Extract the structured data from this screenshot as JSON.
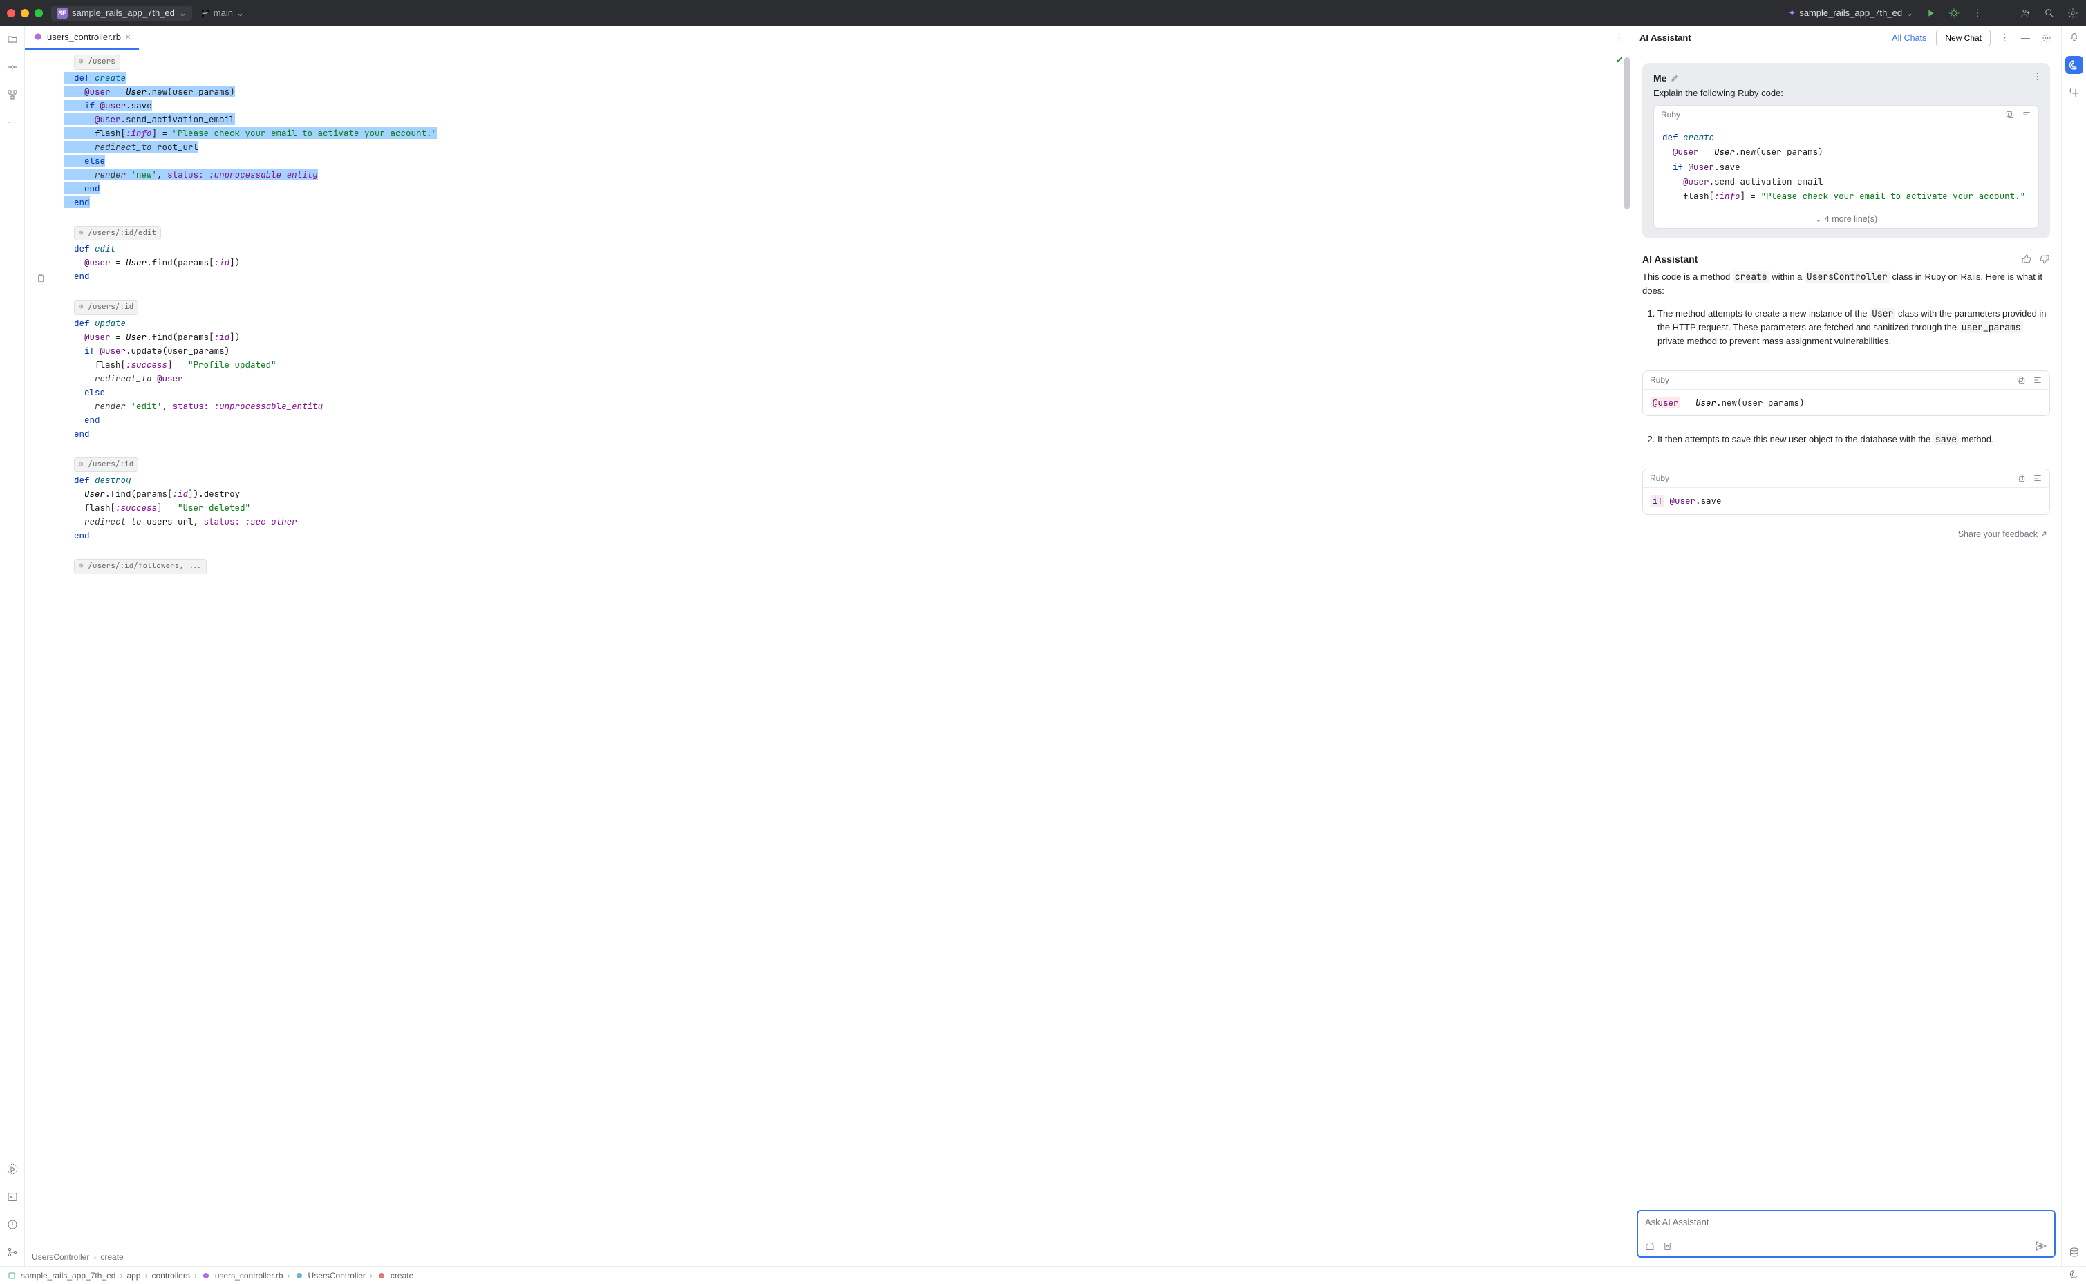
{
  "titlebar": {
    "project_short": "SE",
    "project_name": "sample_rails_app_7th_ed",
    "branch": "main",
    "run_config": "sample_rails_app_7th_ed"
  },
  "tabs": {
    "file_name": "users_controller.rb"
  },
  "routes": {
    "users": "/users",
    "edit": "/users/:id/edit",
    "show": "/users/:id",
    "show2": "/users/:id",
    "followers": "/users/:id/followers, ..."
  },
  "crumbs": {
    "c1": "UsersController",
    "c2": "create"
  },
  "ai": {
    "header": "AI Assistant",
    "all_chats": "All Chats",
    "new_chat": "New Chat",
    "me_label": "Me",
    "me_prompt": "Explain the following Ruby code:",
    "code_lang": "Ruby",
    "more_lines": "4 more line(s)",
    "assistant_label": "AI Assistant",
    "response_p1a": "This code is a method ",
    "response_p1_code1": "create",
    "response_p1b": " within a ",
    "response_p1_code2": "UsersController",
    "response_p1c": " class in Ruby on Rails. Here is what it does:",
    "li1a": "The method attempts to create a new instance of the ",
    "li1_code1": "User",
    "li1b": " class with the parameters provided in the HTTP request. These parameters are fetched and sanitized through the ",
    "li1_code2": "user_params",
    "li1c": " private method to prevent mass assignment vulnerabilities.",
    "li2a": "It then attempts to save this new user object to the database with the ",
    "li2_code1": "save",
    "li2b": " method.",
    "feedback": "Share your feedback ↗",
    "input_placeholder": "Ask AI Assistant"
  },
  "statusbar": {
    "p1": "sample_rails_app_7th_ed",
    "p2": "app",
    "p3": "controllers",
    "p4": "users_controller.rb",
    "p5": "UsersController",
    "p6": "create"
  },
  "chart_data": null
}
